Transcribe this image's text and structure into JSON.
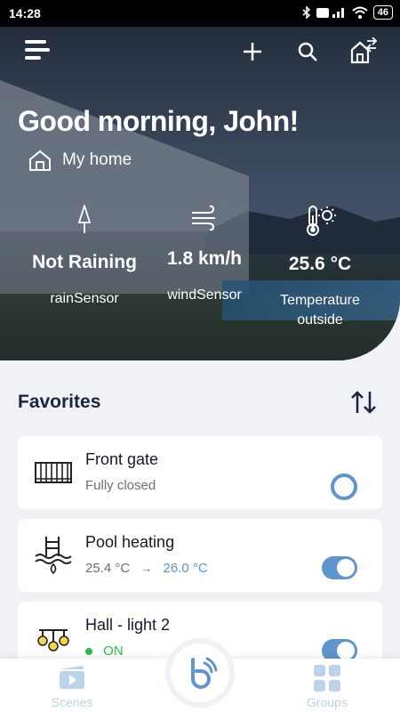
{
  "status_bar": {
    "time": "14:28",
    "battery": "46"
  },
  "hero": {
    "greeting": "Good morning, John!",
    "home_name": "My home",
    "sensors": [
      {
        "value": "Not Raining",
        "label": "rainSensor",
        "icon": "umbrella-icon"
      },
      {
        "value": "1.8 km/h",
        "label": "windSensor",
        "icon": "wind-icon"
      },
      {
        "value": "25.6 °C",
        "label": "Temperature outside",
        "icon": "thermometer-sun-icon"
      }
    ]
  },
  "favorites": {
    "title": "Favorites",
    "items": [
      {
        "name": "Front gate",
        "status": "Fully closed",
        "icon": "gate-icon"
      },
      {
        "name": "Pool heating",
        "current": "25.4 °C",
        "arrow": "→",
        "target": "26.0 °C",
        "icon": "pool-heating-icon"
      },
      {
        "name": "Hall - light 2",
        "status": "ON",
        "icon": "light-icon"
      }
    ]
  },
  "bottom_nav": {
    "scenes": "Scenes",
    "groups": "Groups"
  },
  "colors": {
    "accent": "#5f95cc",
    "on_green": "#2eb84b",
    "title": "#1b2540"
  }
}
